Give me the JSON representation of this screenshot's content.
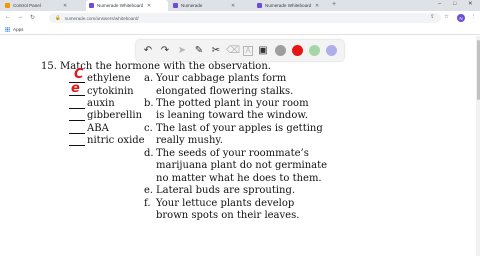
{
  "browser": {
    "tabs": [
      {
        "label": "Control Panel",
        "favicon_color": "#f29900",
        "active": false
      },
      {
        "label": "Numerade Whiteboard",
        "favicon_color": "#6f4bd8",
        "active": true
      },
      {
        "label": "Numerade",
        "favicon_color": "#6f4bd8",
        "active": false
      },
      {
        "label": "Numerade Whiteboard",
        "favicon_color": "#6f4bd8",
        "active": false
      }
    ],
    "new_tab": "+",
    "window_controls": [
      "–",
      "□",
      "✕"
    ],
    "url": "numerade.com/answers/whiteboard/",
    "profile_initial": "N",
    "bookmarks": {
      "apps_label": "Apps"
    }
  },
  "whiteboard": {
    "tools": [
      {
        "icon": "undo-icon",
        "glyph": "↶",
        "enabled": true
      },
      {
        "icon": "redo-icon",
        "glyph": "↷",
        "enabled": true
      },
      {
        "icon": "select-icon",
        "glyph": "➤",
        "enabled": false
      },
      {
        "icon": "pen-icon",
        "glyph": "✎",
        "enabled": true
      },
      {
        "icon": "scissors-icon",
        "glyph": "✂",
        "enabled": true
      },
      {
        "icon": "eraser-icon",
        "glyph": "⌫",
        "enabled": false
      },
      {
        "icon": "text-icon",
        "glyph": "A",
        "enabled": false
      },
      {
        "icon": "image-icon",
        "glyph": "▣",
        "enabled": true
      }
    ],
    "colors": [
      "#9e9e9e",
      "#e81313",
      "#a5d6a7",
      "#b0aee8"
    ]
  },
  "question": {
    "number": "15.",
    "prompt": "Match the hormone with the observation.",
    "hormones": [
      {
        "name": "ethylene",
        "answer": "C"
      },
      {
        "name": "cytokinin",
        "answer": "e"
      },
      {
        "name": "auxin",
        "answer": ""
      },
      {
        "name": "gibberellin",
        "answer": ""
      },
      {
        "name": "ABA",
        "answer": ""
      },
      {
        "name": "nitric oxide",
        "answer": ""
      }
    ],
    "observations": [
      {
        "letter": "a.",
        "lines": [
          "Your cabbage plants form",
          "elongated flowering stalks."
        ]
      },
      {
        "letter": "b.",
        "lines": [
          "The potted plant in your room",
          "is leaning toward the window."
        ]
      },
      {
        "letter": "c.",
        "lines": [
          "The last of your apples is getting",
          "really mushy."
        ]
      },
      {
        "letter": "d.",
        "lines": [
          "The seeds of your roommate’s",
          "marijuana plant do not germinate",
          "no matter what he does to them."
        ]
      },
      {
        "letter": "e.",
        "lines": [
          "Lateral buds are sprouting."
        ]
      },
      {
        "letter": "f.",
        "lines": [
          "Your lettuce plants develop",
          "brown spots on their leaves."
        ]
      }
    ]
  }
}
